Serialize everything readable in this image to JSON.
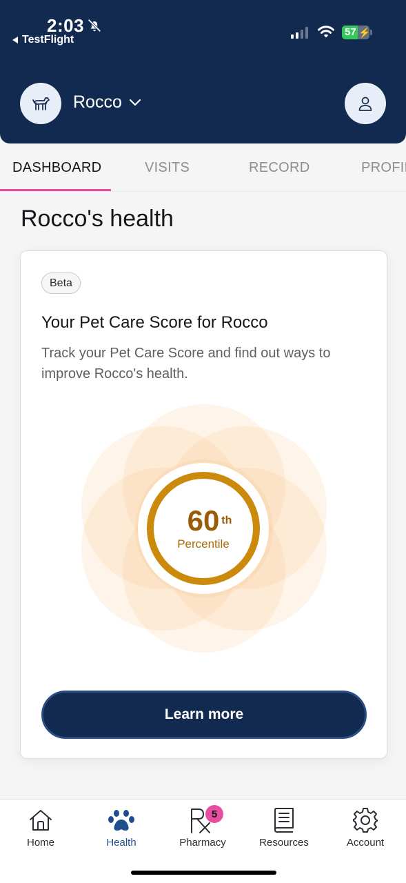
{
  "status_bar": {
    "time": "2:03",
    "back_app": "TestFlight",
    "battery": "57",
    "battery_level": 0.57
  },
  "header": {
    "pet_name": "Rocco"
  },
  "tabs": [
    {
      "label": "DASHBOARD",
      "active": true
    },
    {
      "label": "VISITS",
      "active": false
    },
    {
      "label": "RECORD",
      "active": false
    },
    {
      "label": "PROFIL",
      "active": false
    }
  ],
  "page": {
    "title": "Rocco's health"
  },
  "card": {
    "badge": "Beta",
    "title": "Your Pet Care Score for Rocco",
    "description": "Track your Pet Care Score and find out ways to improve Rocco's health.",
    "score_value": "60",
    "score_suffix": "th",
    "score_label": "Percentile",
    "button": "Learn more"
  },
  "bottom_nav": [
    {
      "label": "Home",
      "icon": "home-icon",
      "active": false
    },
    {
      "label": "Health",
      "icon": "paw-icon",
      "active": true
    },
    {
      "label": "Pharmacy",
      "icon": "rx-icon",
      "active": false,
      "badge": "5"
    },
    {
      "label": "Resources",
      "icon": "book-icon",
      "active": false
    },
    {
      "label": "Account",
      "icon": "gear-icon",
      "active": false
    }
  ],
  "colors": {
    "header_bg": "#132a50",
    "accent_pink": "#e74ea1",
    "score_ring": "#cc8a0c",
    "active_nav": "#1f4d8f"
  }
}
